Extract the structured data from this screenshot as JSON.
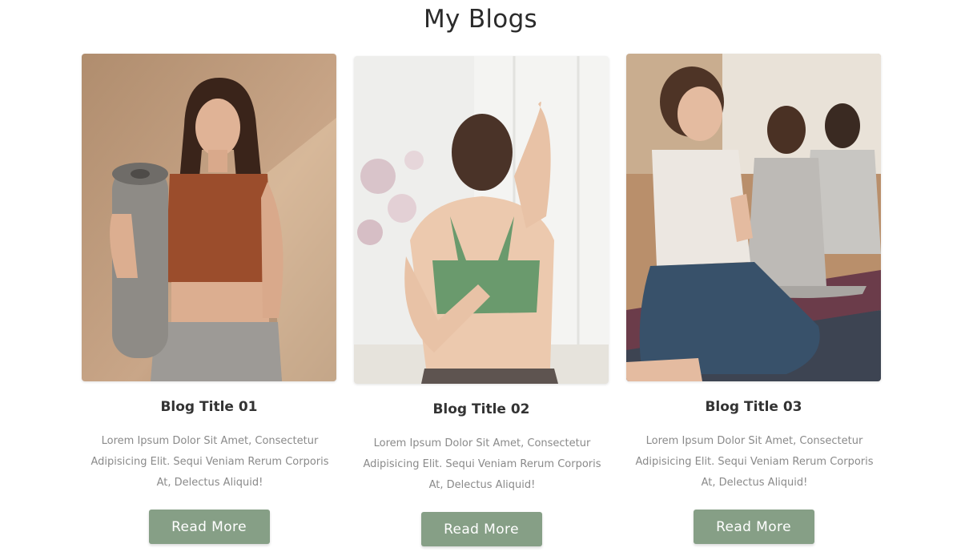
{
  "section": {
    "title": "My Blogs"
  },
  "colors": {
    "accent": "#869f86",
    "heading": "#333333",
    "body_text": "#8a8a8a",
    "background": "#ffffff"
  },
  "blogs": [
    {
      "title": "Blog Title 01",
      "excerpt": "Lorem Ipsum Dolor Sit Amet, Consectetur Adipisicing Elit. Sequi Veniam Rerum Corporis At, Delectus Aliquid!",
      "button_label": "Read More",
      "image_description": "woman holding yoga mat"
    },
    {
      "title": "Blog Title 02",
      "excerpt": "Lorem Ipsum Dolor Sit Amet, Consectetur Adipisicing Elit. Sequi Veniam Rerum Corporis At, Delectus Aliquid!",
      "button_label": "Read More",
      "image_description": "woman doing back stretch"
    },
    {
      "title": "Blog Title 03",
      "excerpt": "Lorem Ipsum Dolor Sit Amet, Consectetur Adipisicing Elit. Sequi Veniam Rerum Corporis At, Delectus Aliquid!",
      "button_label": "Read More",
      "image_description": "yoga class kneeling in prayer pose"
    }
  ]
}
